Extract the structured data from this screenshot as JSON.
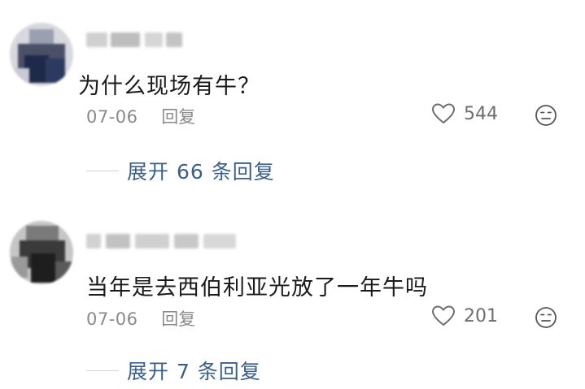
{
  "comments": [
    {
      "text": "为什么现场有牛？",
      "date": "07-06",
      "reply_label": "回复",
      "like_count": "544",
      "expand_label": "展开 66 条回复"
    },
    {
      "text": "当年是去西伯利亚光放了一年牛吗",
      "date": "07-06",
      "reply_label": "回复",
      "like_count": "201",
      "expand_label": "展开 7 条回复"
    }
  ],
  "icons": {
    "like": "heart-outline-icon",
    "dislike": "frown-face-icon"
  },
  "colors": {
    "expand_link": "#3a5f8a",
    "meta_text": "#8a8a8a",
    "body_text": "#1a1a1a"
  }
}
